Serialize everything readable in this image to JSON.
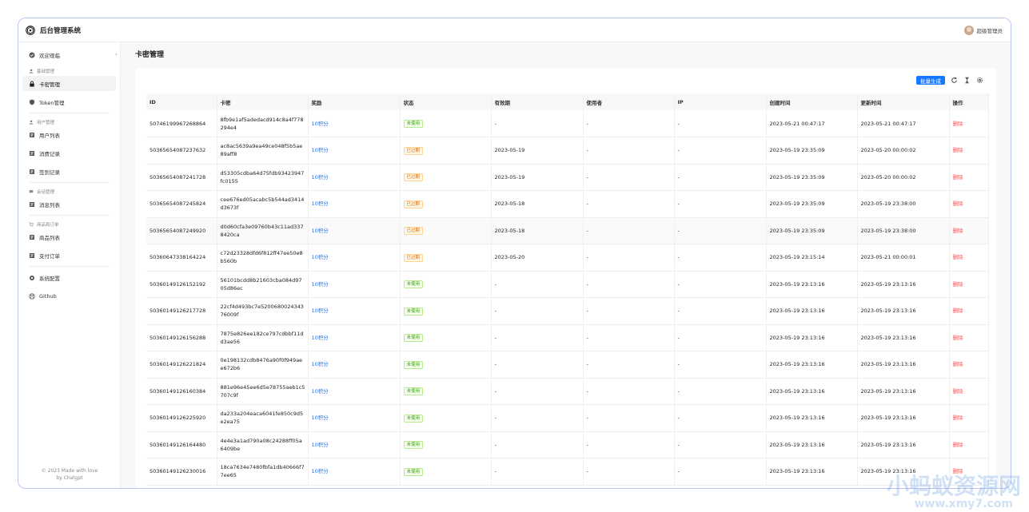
{
  "header": {
    "app_title": "后台管理系统",
    "user_name": "超级管理员"
  },
  "sidebar": {
    "items": [
      {
        "type": "item",
        "label": "欢迎观临",
        "icon": "check-circle-icon"
      },
      {
        "type": "group",
        "label": "基础管理",
        "icon": "user-icon"
      },
      {
        "type": "item",
        "label": "卡密管理",
        "icon": "lock-icon",
        "active": true
      },
      {
        "type": "item",
        "label": "Token管理",
        "icon": "shield-icon"
      },
      {
        "type": "sep"
      },
      {
        "type": "group",
        "label": "用户管理",
        "icon": "user-icon"
      },
      {
        "type": "item",
        "label": "用户列表",
        "icon": "list-icon"
      },
      {
        "type": "item",
        "label": "消费记录",
        "icon": "list-icon"
      },
      {
        "type": "item",
        "label": "签到记录",
        "icon": "list-icon"
      },
      {
        "type": "sep"
      },
      {
        "type": "group",
        "label": "会话管理",
        "icon": "chat-icon"
      },
      {
        "type": "item",
        "label": "消息列表",
        "icon": "list-icon"
      },
      {
        "type": "sep"
      },
      {
        "type": "group",
        "label": "商品和订单",
        "icon": "cart-icon"
      },
      {
        "type": "item",
        "label": "商品列表",
        "icon": "list-icon"
      },
      {
        "type": "item",
        "label": "支付订单",
        "icon": "list-icon"
      },
      {
        "type": "sep"
      },
      {
        "type": "item",
        "label": "系统配置",
        "icon": "gear-icon"
      },
      {
        "type": "item",
        "label": "Github",
        "icon": "github-icon"
      }
    ],
    "footer_line1": "© 2023 Made with love",
    "footer_line2": "by Chatgpt"
  },
  "main": {
    "page_title": "卡密管理",
    "batch_button": "批量生成",
    "columns": [
      "ID",
      "卡密",
      "奖励",
      "状态",
      "有效期",
      "使用者",
      "IP",
      "创建时间",
      "更新时间",
      "操作"
    ],
    "rows": [
      {
        "id": "50746199967268864",
        "key": "8fb9e1af5adedacd914c8a4f778294e4",
        "reward": "10积分",
        "status": "未使用",
        "status_type": "unused",
        "expire": "-",
        "user": "-",
        "ip": "-",
        "created": "2023-05-21 00:47:17",
        "updated": "2023-05-21 00:47:17",
        "action": "删除"
      },
      {
        "id": "50365654087237632",
        "key": "ac8ac5639a9ea49ce048f5b5ae89aff8",
        "reward": "10积分",
        "status": "已过期",
        "status_type": "expired",
        "expire": "2023-05-19",
        "user": "-",
        "ip": "-",
        "created": "2023-05-19 23:35:09",
        "updated": "2023-05-20 00:00:02",
        "action": "删除"
      },
      {
        "id": "50365654087241728",
        "key": "d53305cdba64d75fdb93423947fc0155",
        "reward": "10积分",
        "status": "已过期",
        "status_type": "expired",
        "expire": "2023-05-19",
        "user": "-",
        "ip": "-",
        "created": "2023-05-19 23:35:09",
        "updated": "2023-05-20 00:00:02",
        "action": "删除"
      },
      {
        "id": "50365654087245824",
        "key": "cee676ed05acabc5b544ad3414d3673f",
        "reward": "10积分",
        "status": "已过期",
        "status_type": "expired",
        "expire": "2023-05-18",
        "user": "-",
        "ip": "-",
        "created": "2023-05-19 23:35:09",
        "updated": "2023-05-19 23:38:00",
        "action": "删除"
      },
      {
        "id": "50365654087249920",
        "key": "d0d60cfa3e09760b43c11ad3378420ca",
        "reward": "10积分",
        "status": "已过期",
        "status_type": "expired",
        "expire": "2023-05-18",
        "user": "-",
        "ip": "-",
        "created": "2023-05-19 23:35:09",
        "updated": "2023-05-19 23:38:00",
        "action": "删除",
        "highlight": true
      },
      {
        "id": "50360647338164224",
        "key": "c72d23328dfd6f812ff47ee50e8b560b",
        "reward": "10积分",
        "status": "已过期",
        "status_type": "expired",
        "expire": "2023-05-20",
        "user": "-",
        "ip": "-",
        "created": "2023-05-19 23:15:14",
        "updated": "2023-05-21 00:00:01",
        "action": "删除"
      },
      {
        "id": "50360149126152192",
        "key": "56101bcdd8b21603cba084d9705d86ec",
        "reward": "10积分",
        "status": "未使用",
        "status_type": "unused",
        "expire": "-",
        "user": "-",
        "ip": "-",
        "created": "2023-05-19 23:13:16",
        "updated": "2023-05-19 23:13:16",
        "action": "删除"
      },
      {
        "id": "50360149126217728",
        "key": "22cf4d493bc7e520068002434376009f",
        "reward": "10积分",
        "status": "未使用",
        "status_type": "unused",
        "expire": "-",
        "user": "-",
        "ip": "-",
        "created": "2023-05-19 23:13:16",
        "updated": "2023-05-19 23:13:16",
        "action": "删除"
      },
      {
        "id": "50360149126156288",
        "key": "7875e826ee182ce797cdbbf11dd3ae56",
        "reward": "10积分",
        "status": "未使用",
        "status_type": "unused",
        "expire": "-",
        "user": "-",
        "ip": "-",
        "created": "2023-05-19 23:13:16",
        "updated": "2023-05-19 23:13:16",
        "action": "删除"
      },
      {
        "id": "50360149126221824",
        "key": "0e198132cdb8476a90f0f949aee672b6",
        "reward": "10积分",
        "status": "未使用",
        "status_type": "unused",
        "expire": "-",
        "user": "-",
        "ip": "-",
        "created": "2023-05-19 23:13:16",
        "updated": "2023-05-19 23:13:16",
        "action": "删除"
      },
      {
        "id": "50360149126160384",
        "key": "881e96e45ee6d5e78755aeb1c5707c9f",
        "reward": "10积分",
        "status": "未使用",
        "status_type": "unused",
        "expire": "-",
        "user": "-",
        "ip": "-",
        "created": "2023-05-19 23:13:16",
        "updated": "2023-05-19 23:13:16",
        "action": "删除"
      },
      {
        "id": "50360149126225920",
        "key": "da233a204eaca6041fe850c9d5e2ea75",
        "reward": "10积分",
        "status": "未使用",
        "status_type": "unused",
        "expire": "-",
        "user": "-",
        "ip": "-",
        "created": "2023-05-19 23:13:16",
        "updated": "2023-05-19 23:13:16",
        "action": "删除"
      },
      {
        "id": "50360149126164480",
        "key": "4e4e3a1ad790a08c24288ff05a6409be",
        "reward": "10积分",
        "status": "未使用",
        "status_type": "unused",
        "expire": "-",
        "user": "-",
        "ip": "-",
        "created": "2023-05-19 23:13:16",
        "updated": "2023-05-19 23:13:16",
        "action": "删除"
      },
      {
        "id": "50360149126230016",
        "key": "18ca7634e7480fbfa1db40666f77ee65",
        "reward": "10积分",
        "status": "未使用",
        "status_type": "unused",
        "expire": "-",
        "user": "-",
        "ip": "-",
        "created": "2023-05-19 23:13:16",
        "updated": "2023-05-19 23:13:16",
        "action": "删除"
      }
    ]
  },
  "watermark": {
    "line1": "小蚂蚁资源网",
    "line2": "www.xmy7.com"
  },
  "colors": {
    "accent": "#1677ff",
    "danger": "#ff4d4f",
    "frame_border": "#b9c3f3"
  }
}
